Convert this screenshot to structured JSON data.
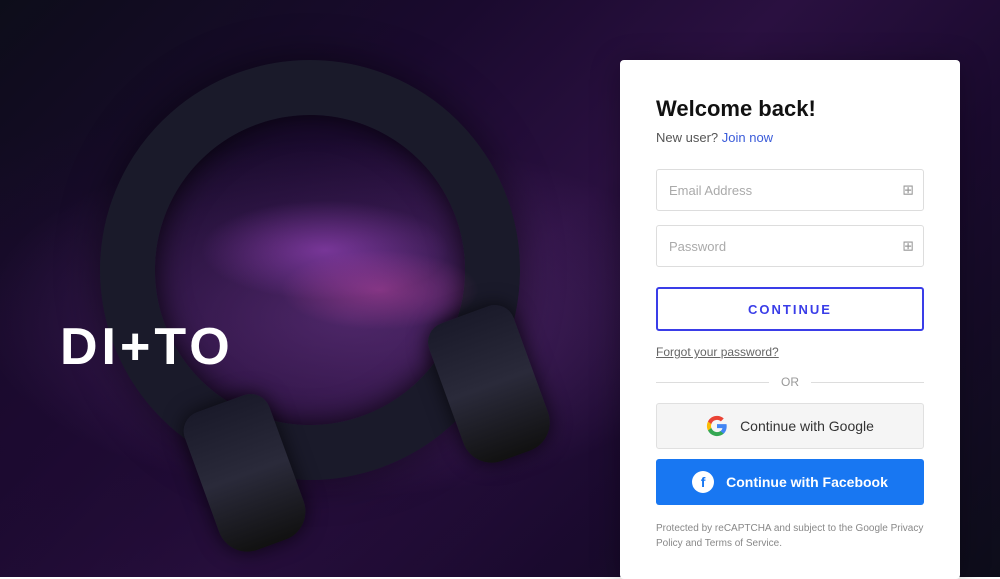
{
  "app": {
    "logo": "DI+TO"
  },
  "login": {
    "title": "Welcome back!",
    "new_user_prefix": "New user?",
    "join_label": "Join now",
    "email_placeholder": "Email Address",
    "password_placeholder": "Password",
    "continue_label": "CONTINUE",
    "forgot_label": "Forgot your password?",
    "or_label": "OR",
    "google_label": "Continue with Google",
    "facebook_label": "Continue with Facebook",
    "recaptcha_text": "Protected by reCAPTCHA and subject to the Google Privacy Policy and Terms of Service."
  },
  "colors": {
    "accent": "#3a3de8",
    "facebook": "#1877f2",
    "link": "#3a5bd9"
  }
}
